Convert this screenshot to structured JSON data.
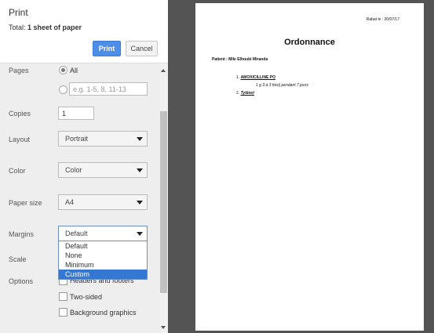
{
  "dialog": {
    "title": "Print",
    "total_prefix": "Total: ",
    "total_value": "1 sheet of paper",
    "print_button": "Print",
    "cancel_button": "Cancel"
  },
  "settings": {
    "pages": {
      "label": "Pages",
      "all_label": "All",
      "custom_placeholder": "e.g. 1-5, 8, 11-13",
      "selected": "All"
    },
    "copies": {
      "label": "Copies",
      "value": "1"
    },
    "layout": {
      "label": "Layout",
      "value": "Portrait"
    },
    "color": {
      "label": "Color",
      "value": "Color"
    },
    "paper_size": {
      "label": "Paper size",
      "value": "A4"
    },
    "margins": {
      "label": "Margins",
      "value": "Default",
      "options": [
        "Default",
        "None",
        "Minimum",
        "Custom"
      ],
      "highlighted": "Custom"
    },
    "scale": {
      "label": "Scale"
    },
    "options": {
      "label": "Options",
      "headers_footers": "Headers and footers",
      "two_sided": "Two-sided",
      "background_graphics": "Background graphics"
    }
  },
  "preview": {
    "date_line": "Rabat le : 20/07/17",
    "title": "Ordonnance",
    "patient_line": "Patient : Mlle Elhoubi Miranda",
    "item1_number": "1.",
    "item1_name": "AMOXICILLINE PO",
    "item1_dose": "1 g 3 à 3 fois/j pendant 7 jours",
    "item2_number": "2.",
    "item2_name": "Tylénol"
  },
  "colors": {
    "print_button": "#4d8ee9",
    "preview_background": "#545454",
    "dropdown_highlight": "#3478d4"
  }
}
